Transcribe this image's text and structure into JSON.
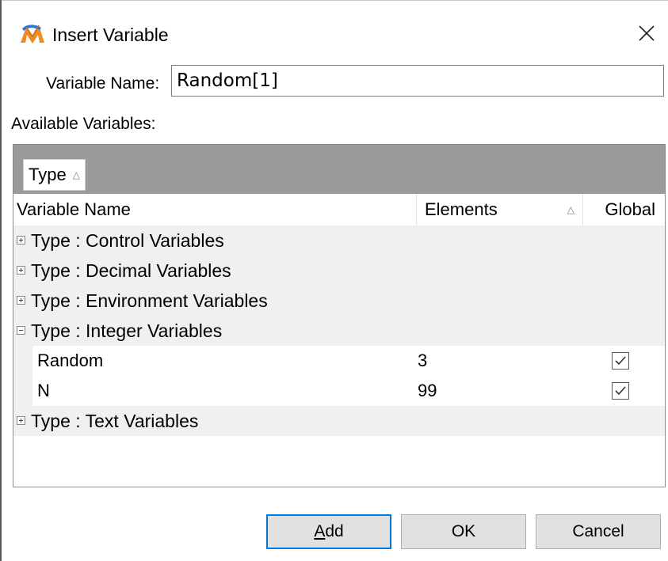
{
  "window": {
    "title": "Insert Variable",
    "app_icon": "maplesim-logo-icon",
    "close_icon": "close-icon"
  },
  "variable_name": {
    "label": "Variable Name:",
    "value": "Random[1]"
  },
  "available": {
    "label": "Available Variables:",
    "group_by": {
      "label": "Type",
      "sort_icon": "sort-ascending-icon"
    },
    "columns": {
      "name": "Variable Name",
      "elements": "Elements",
      "global": "Global"
    },
    "groups": [
      {
        "label": "Type : Control Variables",
        "expanded": false
      },
      {
        "label": "Type : Decimal Variables",
        "expanded": false
      },
      {
        "label": "Type : Environment Variables",
        "expanded": false
      },
      {
        "label": "Type : Integer Variables",
        "expanded": true
      },
      {
        "label": "Type : Text Variables",
        "expanded": false
      }
    ],
    "integer_rows": [
      {
        "name": "Random",
        "elements": "3",
        "global": true
      },
      {
        "name": "N",
        "elements": "99",
        "global": true
      }
    ]
  },
  "buttons": {
    "add": "A",
    "add_rest": "dd",
    "ok": "OK",
    "cancel": "Cancel"
  },
  "colors": {
    "accent": "#0078d7",
    "group_panel": "#9a9a9a",
    "row_alt": "#f0f0f0"
  }
}
